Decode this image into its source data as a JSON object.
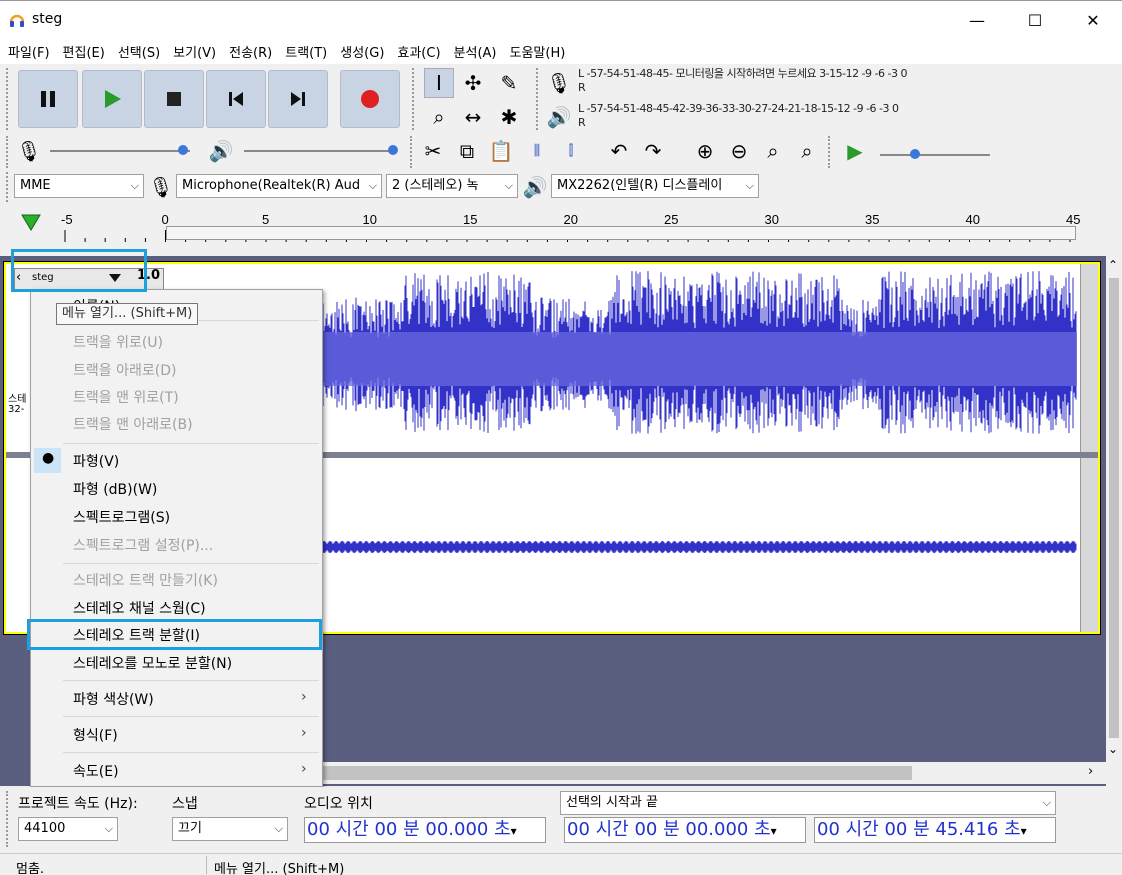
{
  "window": {
    "title": "steg",
    "minimize": "—",
    "maximize": "☐",
    "close": "✕"
  },
  "menubar": [
    "파일(F)",
    "편집(E)",
    "선택(S)",
    "보기(V)",
    "전송(R)",
    "트랙(T)",
    "생성(G)",
    "효과(C)",
    "분석(A)",
    "도움말(H)"
  ],
  "meters": {
    "record_scale": "-57-54-51-48-45-",
    "record_prompt": "모니터링을 시작하려면 누르세요",
    "record_scale_tail": "3-15-12 -9  -6  -3  0",
    "play_scale": "-57-54-51-48-45-42-39-36-33-30-27-24-21-18-15-12 -9  -6  -3  0",
    "l": "L",
    "r": "R"
  },
  "devices": {
    "host": "MME",
    "input": "Microphone(Realtek(R) Aud",
    "channels": "2 (스테레오) 녹",
    "output": "MX2262(인텔(R) 디스플레이"
  },
  "ruler": {
    "ticks": [
      "-5",
      "0",
      "5",
      "10",
      "15",
      "20",
      "25",
      "30",
      "35",
      "40",
      "45"
    ]
  },
  "track": {
    "name": "steg",
    "zoom": "1.0",
    "side_label": "스테",
    "side_label2": "32-"
  },
  "tooltip": "메뉴 열기... (Shift+M)",
  "context_menu": {
    "items": [
      {
        "label": "이름(N)...",
        "disabled": false
      },
      {
        "label": "트랙을 위로(U)",
        "disabled": true
      },
      {
        "label": "트랙을 아래로(D)",
        "disabled": true
      },
      {
        "label": "트랙을 맨 위로(T)",
        "disabled": true
      },
      {
        "label": "트랙을 맨 아래로(B)",
        "disabled": true
      },
      {
        "label": "파형(V)",
        "disabled": false
      },
      {
        "label": "파형 (dB)(W)",
        "disabled": false
      },
      {
        "label": "스펙트로그램(S)",
        "disabled": false
      },
      {
        "label": "스펙트로그램 설정(P)...",
        "disabled": true
      },
      {
        "label": "스테레오 트랙 만들기(K)",
        "disabled": true
      },
      {
        "label": "스테레오 채널 스웝(C)",
        "disabled": false
      },
      {
        "label": "스테레오 트랙 분할(I)",
        "disabled": false
      },
      {
        "label": "스테레오를 모노로 분할(N)",
        "disabled": false
      },
      {
        "label": "파형 색상(W)",
        "disabled": false
      },
      {
        "label": "형식(F)",
        "disabled": false
      },
      {
        "label": "속도(E)",
        "disabled": false
      }
    ]
  },
  "bottom": {
    "rate_label": "프로젝트 속도 (Hz):",
    "rate_value": "44100",
    "snap_label": "스냅",
    "snap_value": "끄기",
    "audio_pos_label": "오디오 위치",
    "audio_pos_value": "00 시간 00 분 00.000 초",
    "selection_label": "선택의 시작과 끝",
    "sel_start": "00 시간 00 분 00.000 초",
    "sel_end": "00 시간 00 분 45.416 초"
  },
  "status": {
    "state": "멈춤.",
    "message": "메뉴 열기... (Shift+M)"
  },
  "colors": {
    "waveform": "#3232c8",
    "highlight": "#1ea0e0",
    "track_bg": "#5a5f80"
  }
}
